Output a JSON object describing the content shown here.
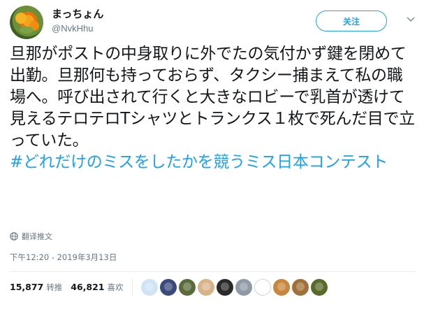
{
  "user": {
    "display_name": "まっちょん",
    "handle": "@NvkHhu"
  },
  "actions": {
    "follow_label": "关注",
    "more_icon": "chevron-down-icon"
  },
  "tweet": {
    "text": "旦那がポストの中身取りに外でたの気付かず鍵を閉めて出勤。旦那何も持っておらず、タクシー捕まえて私の職場へ。呼び出されて行くと大きなロビーで乳首が透けて見えるテロテロTシャツとトランクス１枚で死んだ目で立っていた。",
    "hashtag": "#どれだけのミスをしたかを競うミス日本コンテスト"
  },
  "translate": {
    "label": "翻译推文",
    "icon": "globe-icon"
  },
  "timestamp": "下午12:20 - 2019年3月13日",
  "stats": {
    "retweets_count": "15,877",
    "retweets_label": "转推",
    "likes_count": "46,821",
    "likes_label": "喜欢"
  },
  "likers": {
    "avatar_colors": [
      "#cfe3f5",
      "#3a4a7a",
      "#5b6b3a",
      "#d8b38a",
      "#2a2a2a",
      "#8f9aa6",
      "#ffffff",
      "#c8873d",
      "#a0703a",
      "#5a6a2a"
    ]
  }
}
